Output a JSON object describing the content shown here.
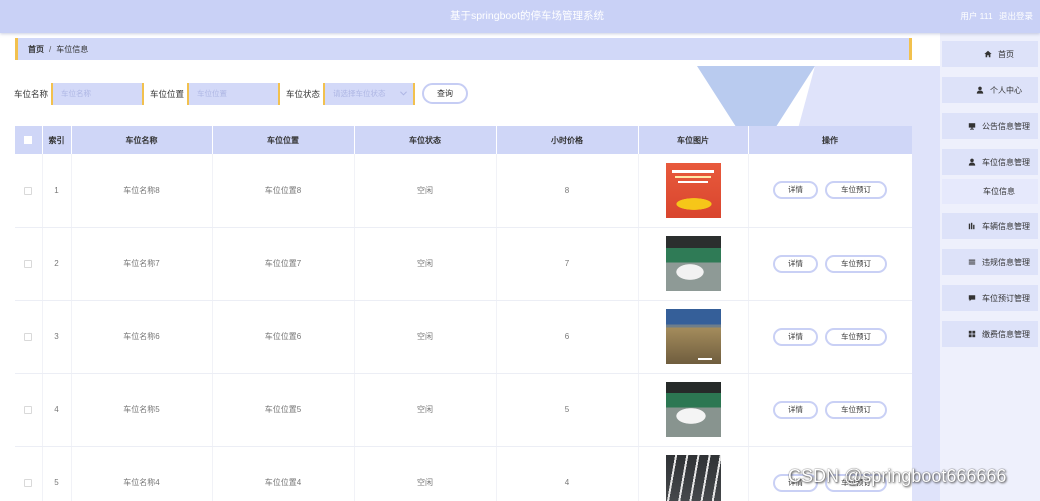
{
  "header": {
    "title": "基于springboot的停车场管理系统",
    "user": "用户 111",
    "logout": "退出登录"
  },
  "breadcrumb": {
    "home": "首页",
    "separator": "/",
    "current": "车位信息"
  },
  "search": {
    "name_label": "车位名称",
    "name_placeholder": "车位名称",
    "position_label": "车位位置",
    "position_placeholder": "车位位置",
    "status_label": "车位状态",
    "status_placeholder": "请选择车位状态",
    "query_button": "查询"
  },
  "table": {
    "columns": {
      "index": "索引",
      "name": "车位名称",
      "position": "车位位置",
      "status": "车位状态",
      "price": "小时价格",
      "image": "车位图片",
      "actions": "操作"
    },
    "rows": [
      {
        "index": "1",
        "name": "车位名称8",
        "position": "车位位置8",
        "status": "空闲",
        "price": "8"
      },
      {
        "index": "2",
        "name": "车位名称7",
        "position": "车位位置7",
        "status": "空闲",
        "price": "7"
      },
      {
        "index": "3",
        "name": "车位名称6",
        "position": "车位位置6",
        "status": "空闲",
        "price": "6"
      },
      {
        "index": "4",
        "name": "车位名称5",
        "position": "车位位置5",
        "status": "空闲",
        "price": "5"
      },
      {
        "index": "5",
        "name": "车位名称4",
        "position": "车位位置4",
        "status": "空闲",
        "price": "4"
      }
    ],
    "detail_button": "详情",
    "reserve_button": "车位预订"
  },
  "sidebar": {
    "items": [
      {
        "label": "首页",
        "icon": "home-icon"
      },
      {
        "label": "个人中心",
        "icon": "user-icon"
      },
      {
        "label": "公告信息管理",
        "icon": "monitor-icon"
      },
      {
        "label": "车位信息管理",
        "icon": "user-icon",
        "children": [
          {
            "label": "车位信息"
          }
        ]
      },
      {
        "label": "车辆信息管理",
        "icon": "bar-chart-icon"
      },
      {
        "label": "违规信息管理",
        "icon": "list-icon"
      },
      {
        "label": "车位预订管理",
        "icon": "chat-icon"
      },
      {
        "label": "缴费信息管理",
        "icon": "grid-icon"
      }
    ]
  },
  "watermark": "CSDN @springboot666666",
  "colors": {
    "header": "#c9d1f6",
    "accent": "#f2c14e",
    "table_header": "#cfd6f7",
    "sidebar_item": "#dde2f9",
    "decor_triangle": "#b9cbef"
  }
}
